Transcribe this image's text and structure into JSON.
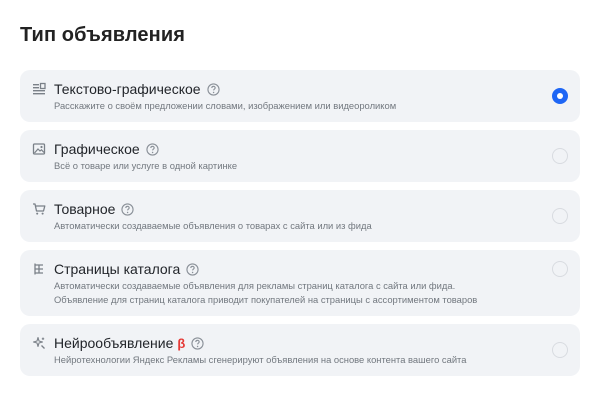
{
  "title": "Тип объявления",
  "options": [
    {
      "icon": "text-graphic-icon",
      "title": "Текстово-графическое",
      "beta": "",
      "desc1": "Расскажите о своём предложении словами, изображением или видеороликом",
      "desc2": "",
      "selected": true
    },
    {
      "icon": "image-icon",
      "title": "Графическое",
      "beta": "",
      "desc1": "Всё о товаре или услуге в одной картинке",
      "desc2": "",
      "selected": false
    },
    {
      "icon": "cart-icon",
      "title": "Товарное",
      "beta": "",
      "desc1": "Автоматически создаваемые объявления о товарах с сайта или из фида",
      "desc2": "",
      "selected": false
    },
    {
      "icon": "catalog-tree-icon",
      "title": "Страницы каталога",
      "beta": "",
      "desc1": "Автоматически создаваемые объявления для рекламы страниц каталога с сайта или фида.",
      "desc2": "Объявление для страниц каталога приводит покупателей на страницы с ассортиментом товаров",
      "selected": false
    },
    {
      "icon": "neuro-sparkle-icon",
      "title": "Нейрообъявление",
      "beta": "β",
      "desc1": "Нейротехнологии Яндекс Рекламы сгенерируют объявления на основе контента вашего сайта",
      "desc2": "",
      "selected": false
    }
  ],
  "colors": {
    "accent": "#1e66f5",
    "card_bg": "#f1f3f6",
    "beta": "#e53935"
  }
}
